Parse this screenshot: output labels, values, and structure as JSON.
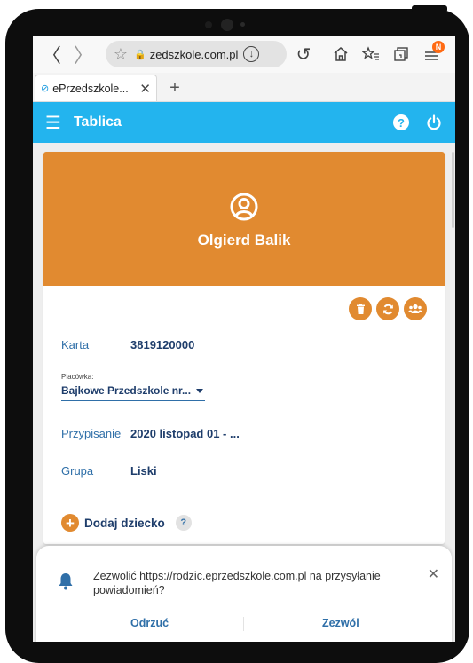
{
  "browser": {
    "url": "zedszkole.com.pl",
    "back_glyph": "〈",
    "forward_glyph": "〉",
    "reload_glyph": "↺",
    "menu_badge": "N",
    "tab": {
      "title": "ePrzedszkole...",
      "close": "✕"
    },
    "new_tab": "+"
  },
  "header": {
    "title": "Tablica",
    "accent": "#23b4ee"
  },
  "profile": {
    "name": "Olgierd Balik",
    "header_color": "#e18a30",
    "action_buttons": [
      "trash-icon",
      "refresh-icon",
      "users-icon"
    ]
  },
  "details": {
    "card_label": "Karta",
    "card_value": "3819120000",
    "facility_label": "Placówka:",
    "facility_value": "Bajkowe Przedszkole nr...",
    "assignment_label": "Przypisanie",
    "assignment_value": "2020 listopad 01 - ...",
    "group_label": "Grupa",
    "group_value": "Liski"
  },
  "add_child": {
    "label": "Dodaj dziecko",
    "help": "?"
  },
  "notification": {
    "message": "Zezwolić https://rodzic.eprzedszkole.com.pl na przysyłanie powiadomień?",
    "deny": "Odrzuć",
    "allow": "Zezwól",
    "close": "✕"
  }
}
